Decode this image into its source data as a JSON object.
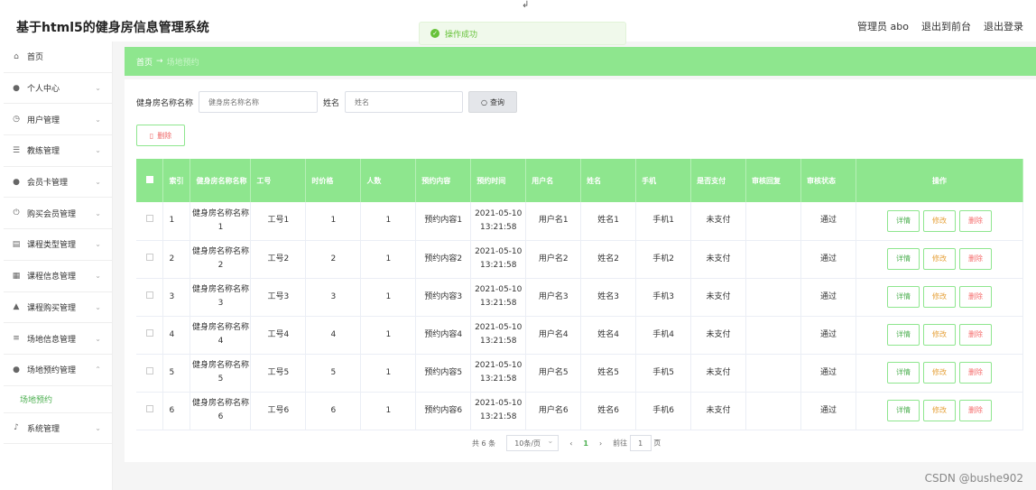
{
  "app": {
    "title": "基于html5的健身房信息管理系统",
    "user": "管理员 abo",
    "back_to_front": "退出到前台",
    "logout": "退出登录"
  },
  "toast": {
    "message": "操作成功"
  },
  "sidebar": {
    "items": [
      {
        "label": "首页",
        "icon": "home-icon"
      },
      {
        "label": "个人中心",
        "icon": "user-icon"
      },
      {
        "label": "用户管理",
        "icon": "clock-icon"
      },
      {
        "label": "教练管理",
        "icon": "sliders-icon"
      },
      {
        "label": "会员卡管理",
        "icon": "user-icon"
      },
      {
        "label": "购买会员管理",
        "icon": "power-icon"
      },
      {
        "label": "课程类型管理",
        "icon": "list-icon"
      },
      {
        "label": "课程信息管理",
        "icon": "doc-icon"
      },
      {
        "label": "课程购买管理",
        "icon": "chart-icon"
      },
      {
        "label": "场地信息管理",
        "icon": "menu-icon"
      },
      {
        "label": "场地预约管理",
        "icon": "user-icon"
      }
    ],
    "sub_item": "场地预约",
    "last_item": "系统管理"
  },
  "breadcrumb": {
    "home": "首页",
    "arrow": "→",
    "current": "场地预约"
  },
  "search": {
    "gym_label": "健身房名称名称",
    "gym_placeholder": "健身房名称名称",
    "name_label": "姓名",
    "name_placeholder": "姓名",
    "query_label": "查询"
  },
  "delete_label": "删除",
  "table": {
    "headers": [
      "索引",
      "健身房名称名称",
      "工号",
      "时价格",
      "人数",
      "预约内容",
      "预约时间",
      "用户名",
      "姓名",
      "手机",
      "是否支付",
      "审核回复",
      "审核状态",
      "操作"
    ],
    "rows": [
      {
        "idx": "1",
        "gym": "健身房名称名称1",
        "no": "工号1",
        "price": "1",
        "count": "1",
        "content": "预约内容1",
        "date": "2021-05-10",
        "time": "13:21:58",
        "user": "用户名1",
        "name": "姓名1",
        "phone": "手机1",
        "paid": "未支付",
        "reply": "",
        "status": "通过"
      },
      {
        "idx": "2",
        "gym": "健身房名称名称2",
        "no": "工号2",
        "price": "2",
        "count": "1",
        "content": "预约内容2",
        "date": "2021-05-10",
        "time": "13:21:58",
        "user": "用户名2",
        "name": "姓名2",
        "phone": "手机2",
        "paid": "未支付",
        "reply": "",
        "status": "通过"
      },
      {
        "idx": "3",
        "gym": "健身房名称名称3",
        "no": "工号3",
        "price": "3",
        "count": "1",
        "content": "预约内容3",
        "date": "2021-05-10",
        "time": "13:21:58",
        "user": "用户名3",
        "name": "姓名3",
        "phone": "手机3",
        "paid": "未支付",
        "reply": "",
        "status": "通过"
      },
      {
        "idx": "4",
        "gym": "健身房名称名称4",
        "no": "工号4",
        "price": "4",
        "count": "1",
        "content": "预约内容4",
        "date": "2021-05-10",
        "time": "13:21:58",
        "user": "用户名4",
        "name": "姓名4",
        "phone": "手机4",
        "paid": "未支付",
        "reply": "",
        "status": "通过"
      },
      {
        "idx": "5",
        "gym": "健身房名称名称5",
        "no": "工号5",
        "price": "5",
        "count": "1",
        "content": "预约内容5",
        "date": "2021-05-10",
        "time": "13:21:58",
        "user": "用户名5",
        "name": "姓名5",
        "phone": "手机5",
        "paid": "未支付",
        "reply": "",
        "status": "通过"
      },
      {
        "idx": "6",
        "gym": "健身房名称名称6",
        "no": "工号6",
        "price": "6",
        "count": "1",
        "content": "预约内容6",
        "date": "2021-05-10",
        "time": "13:21:58",
        "user": "用户名6",
        "name": "姓名6",
        "phone": "手机6",
        "paid": "未支付",
        "reply": "",
        "status": "通过"
      }
    ],
    "actions": {
      "view": "详情",
      "edit": "修改",
      "delete": "删除"
    }
  },
  "pager": {
    "total": "共 6 条",
    "page_size": "10条/页",
    "prev": "‹",
    "page": "1",
    "next": "›",
    "goto": "前往",
    "goto_value": "1",
    "page_unit": "页"
  },
  "watermark": "CSDN @bushe902",
  "colors": {
    "accent": "#8ee68e",
    "accent_dark": "#4caf50",
    "danger": "#f56c6c",
    "warn": "#e6a23c"
  }
}
